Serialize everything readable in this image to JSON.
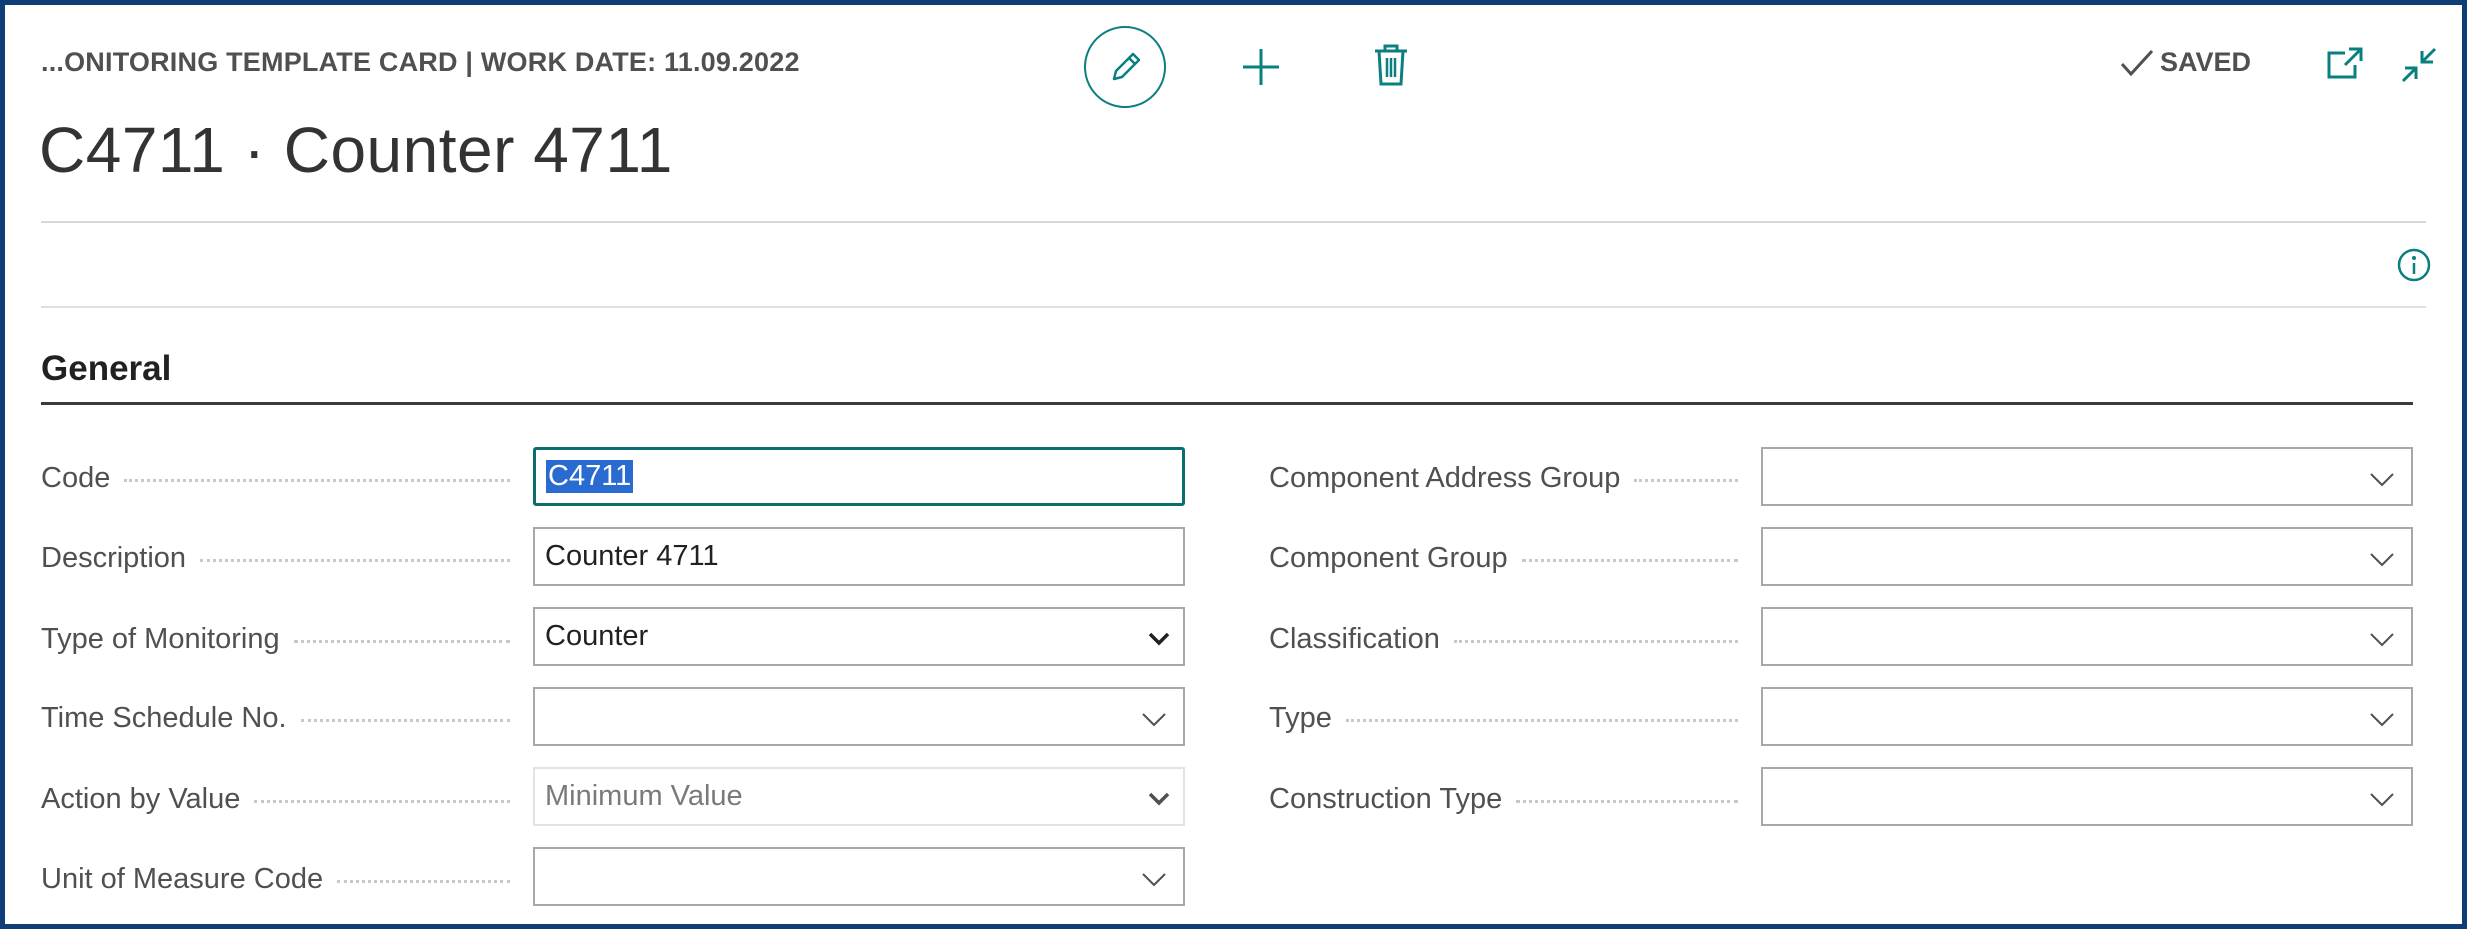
{
  "header": {
    "breadcrumb": "...ONITORING TEMPLATE CARD | WORK DATE: 11.09.2022",
    "title": "C4711 · Counter 4711",
    "status": "SAVED"
  },
  "toolbar": {
    "icons": [
      "pencil-icon",
      "plus-icon",
      "trash-icon",
      "checkmark-icon",
      "popout-icon",
      "collapse-icon",
      "info-icon"
    ]
  },
  "section": {
    "title": "General"
  },
  "left_fields": [
    {
      "label": "Code",
      "value": "C4711"
    },
    {
      "label": "Description",
      "value": "Counter 4711"
    },
    {
      "label": "Type of Monitoring",
      "value": "Counter"
    },
    {
      "label": "Time Schedule No.",
      "value": ""
    },
    {
      "label": "Action by Value",
      "value": "Minimum Value"
    },
    {
      "label": "Unit of Measure Code",
      "value": ""
    }
  ],
  "right_fields": [
    {
      "label": "Component Address Group",
      "value": ""
    },
    {
      "label": "Component Group",
      "value": ""
    },
    {
      "label": "Classification",
      "value": ""
    },
    {
      "label": "Type",
      "value": ""
    },
    {
      "label": "Construction Type",
      "value": ""
    }
  ],
  "colors": {
    "accent": "#0a7f80",
    "frame": "#0e3e75",
    "selection": "#2a6bd1"
  }
}
